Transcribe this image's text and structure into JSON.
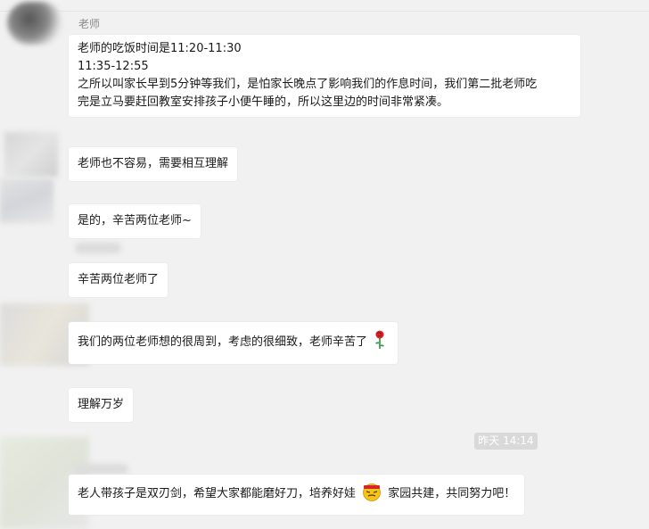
{
  "chat": {
    "sender_name": "老师",
    "messages": [
      {
        "lines": [
          "老师的吃饭时间是11:20-11:30",
          "11:35-12:55",
          "之所以叫家长早到5分钟等我们，是怕家长晚点了影响我们的作息时间，我们第二批老师吃",
          "完是立马要赶回教室安排孩子小便午睡的，所以这里边的时间非常紧凑。"
        ]
      },
      {
        "text": "老师也不容易，需要相互理解"
      },
      {
        "text": "是的，辛苦两位老师~"
      },
      {
        "text": "辛苦两位老师了"
      },
      {
        "text": "我们的两位老师想的很周到，考虑的很细致，老师辛苦了",
        "emoji": "rose-emoji"
      },
      {
        "text": "理解万岁"
      },
      {
        "text_before": "老人带孩子是双刃剑，希望大家都能磨好刀，培养好娃",
        "emoji": "struggle-face-emoji",
        "text_after": "家园共建，共同努力吧！"
      }
    ],
    "timestamp": "昨天 14:14"
  },
  "colors": {
    "background": "#f1f1f1",
    "bubble": "#ffffff",
    "timestamp_bg": "#d9d9d9",
    "rose_red": "#d8232a",
    "emoji_yellow": "#f5c518"
  }
}
